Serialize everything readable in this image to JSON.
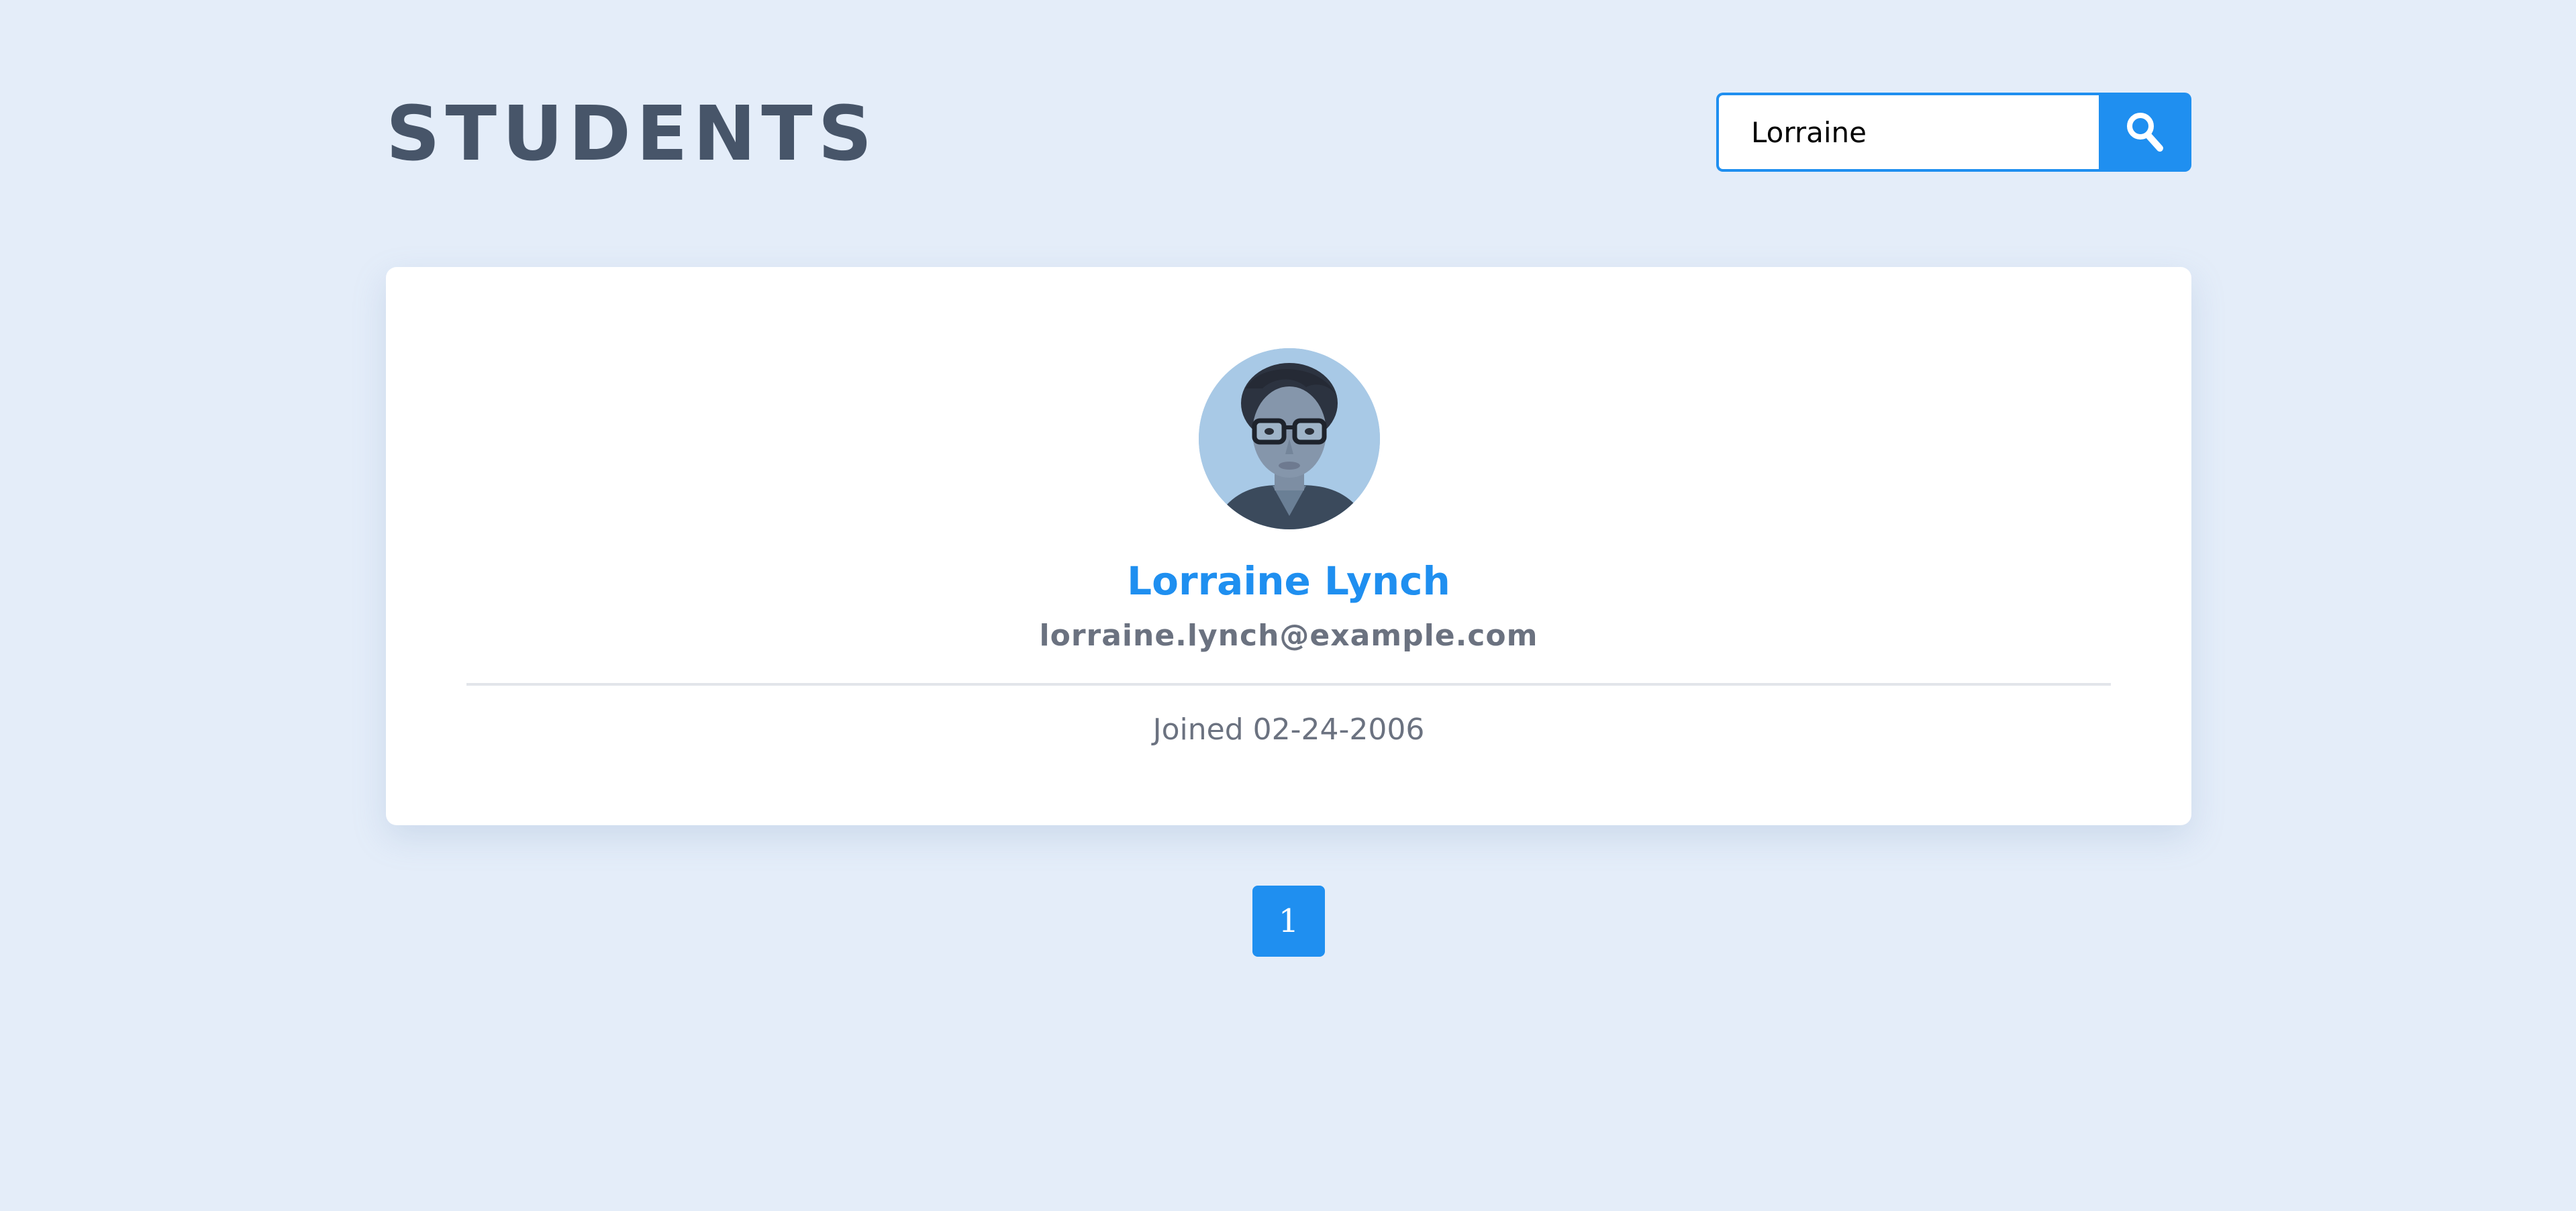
{
  "header": {
    "title": "STUDENTS"
  },
  "search": {
    "value": "Lorraine",
    "button_icon": "search-icon"
  },
  "student": {
    "name": "Lorraine Lynch",
    "email": "lorraine.lynch@example.com",
    "joined": "Joined 02-24-2006",
    "avatar_icon": "avatar-photo"
  },
  "pagination": {
    "pages": [
      "1"
    ],
    "current": "1"
  },
  "colors": {
    "background": "#e4edf9",
    "accent": "#1f8ff0",
    "title": "#475569",
    "muted_text": "#6b7280",
    "card": "#ffffff"
  }
}
